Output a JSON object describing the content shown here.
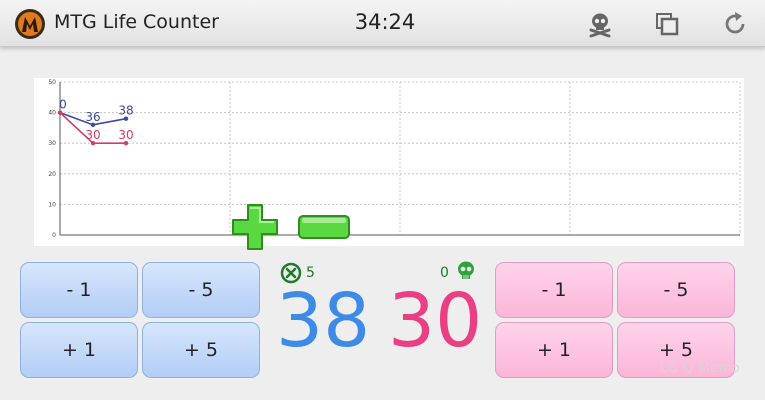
{
  "header": {
    "title": "MTG Life Counter",
    "clock": "34:24",
    "icons": [
      "app-logo-icon",
      "poison-skull-icon",
      "copy-windows-icon",
      "reset-refresh-icon"
    ]
  },
  "chart_data": {
    "type": "line",
    "x": [
      0,
      1,
      2
    ],
    "ylim": [
      0,
      50
    ],
    "yticks": [
      "0",
      "10",
      "20",
      "30",
      "40",
      "50"
    ],
    "grid": true,
    "series": [
      {
        "values": [
          40,
          36,
          38
        ],
        "color": "#3b4aa0",
        "labels": [
          "0",
          "36",
          "38"
        ]
      },
      {
        "values": [
          40,
          30,
          30
        ],
        "color": "#d23c6a",
        "labels": [
          "",
          "30",
          "30"
        ]
      }
    ]
  },
  "player1": {
    "life": "38",
    "poison_or_commander": "5",
    "color": "#3d8be6",
    "buttons": [
      "- 1",
      "- 5",
      "+ 1",
      "+ 5"
    ]
  },
  "player2": {
    "life": "30",
    "poison_count": "0",
    "color": "#ea3f83",
    "buttons": [
      "- 1",
      "- 5",
      "+ 1",
      "+ 5"
    ]
  },
  "watermark": "LG Q Memo",
  "colors": {
    "plus_minus_green": "#4fd33a",
    "counter_green": "#1f7a2a"
  }
}
